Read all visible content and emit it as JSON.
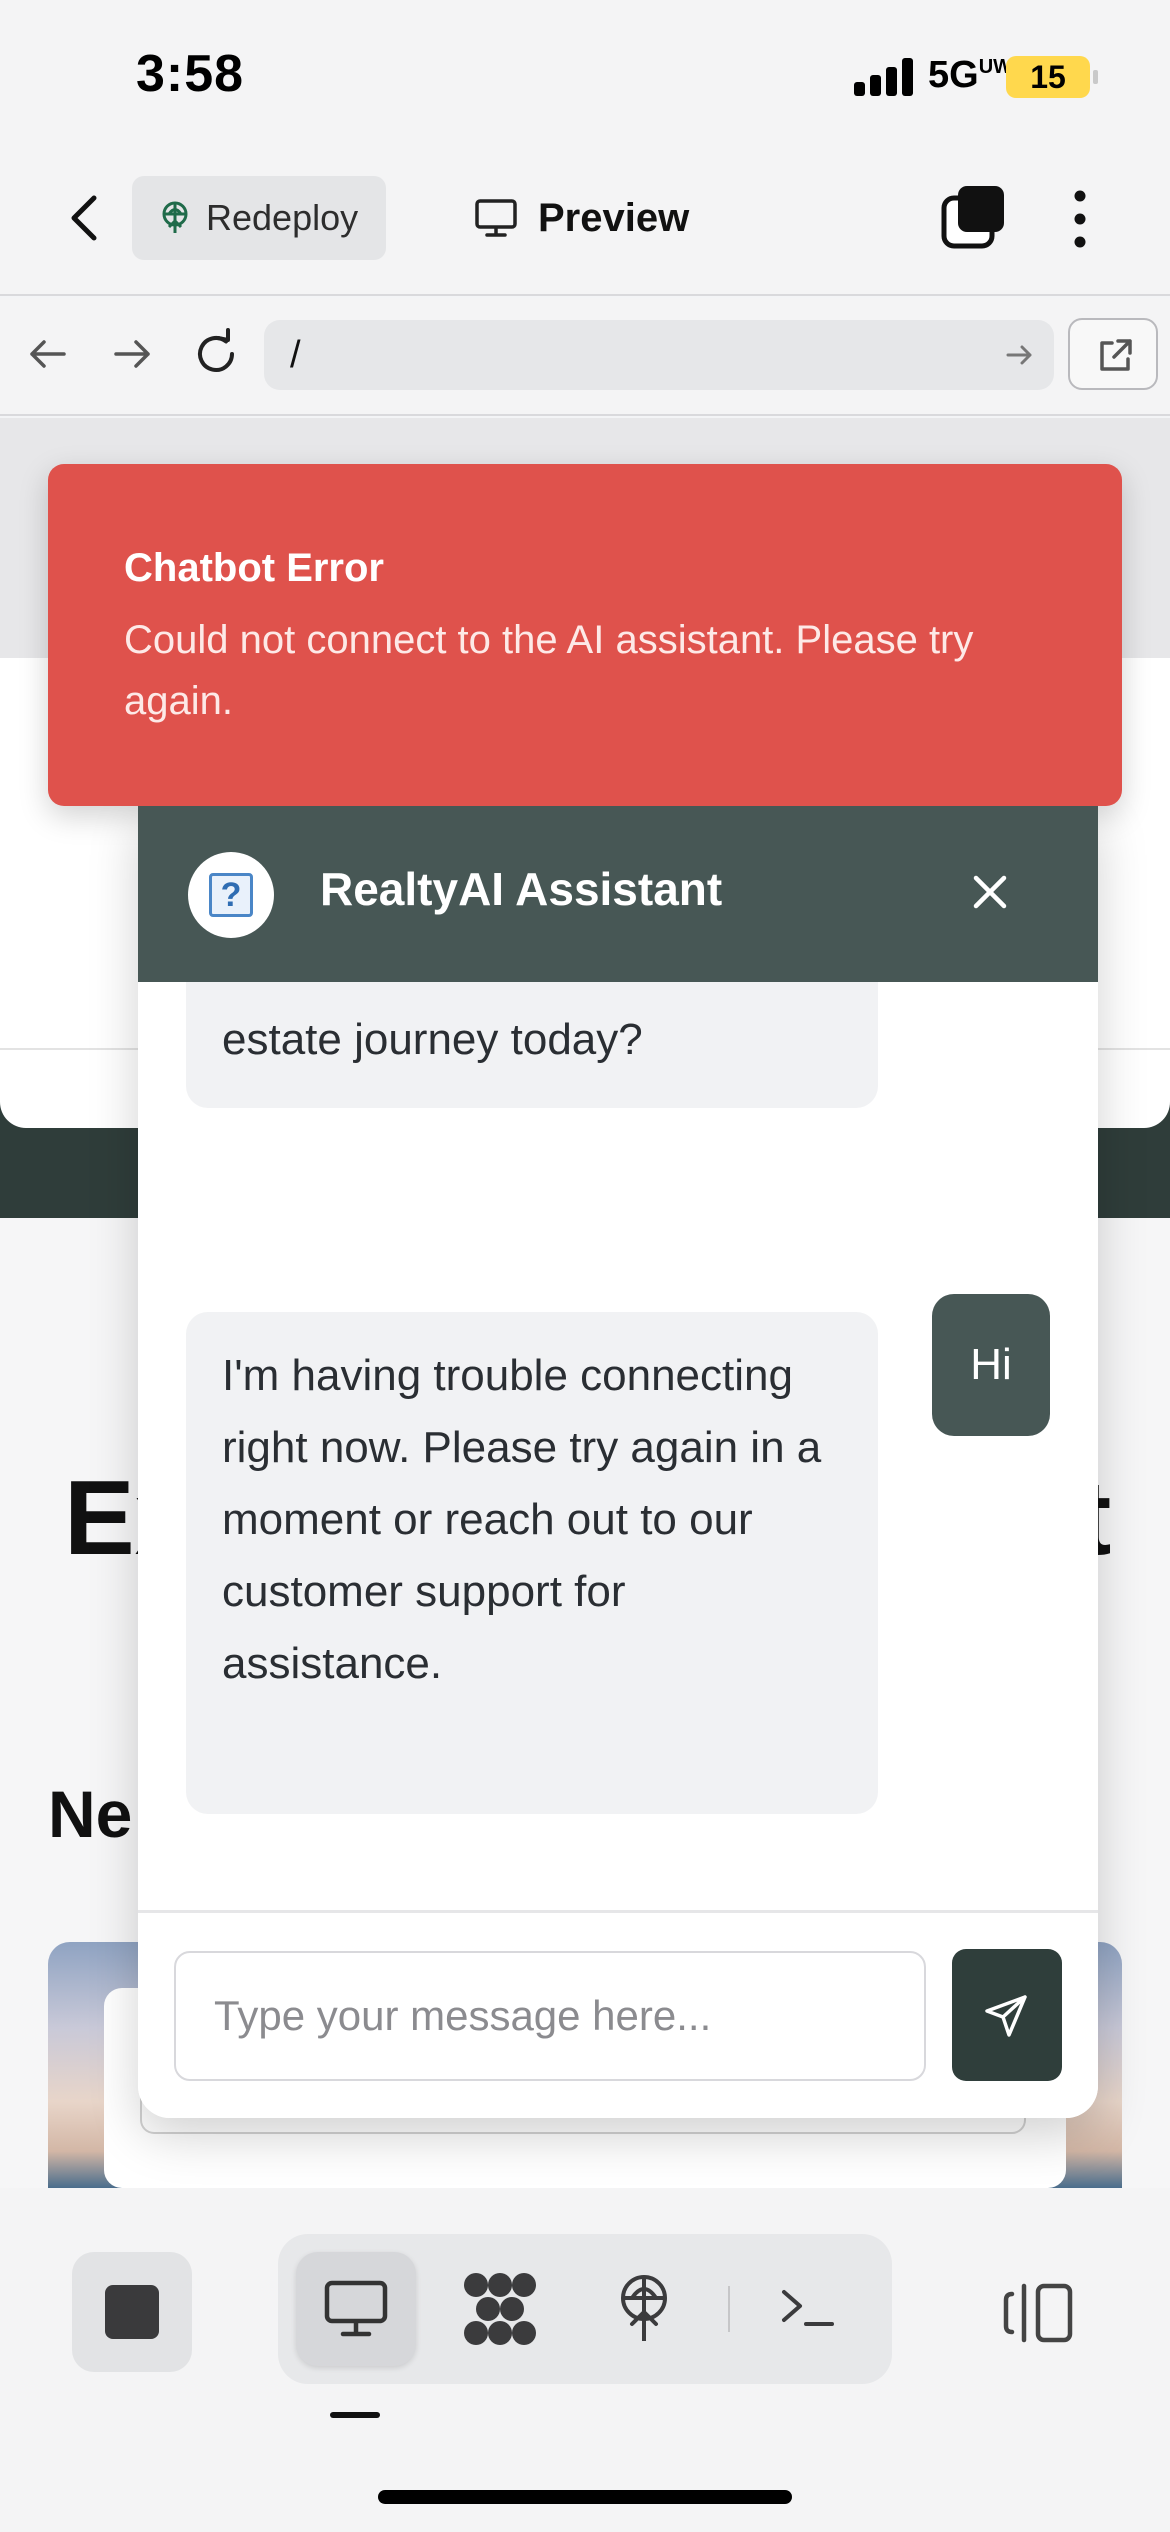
{
  "status_bar": {
    "time": "3:58",
    "network": "5G",
    "network_suffix": "UW",
    "battery": "15"
  },
  "header": {
    "redeploy_label": "Redeploy",
    "preview_label": "Preview"
  },
  "browser": {
    "url": "/"
  },
  "error_toast": {
    "title": "Chatbot Error",
    "message": "Could not connect to the AI assistant. Please try again."
  },
  "chat": {
    "title": "RealtyAI Assistant",
    "messages": [
      {
        "role": "assistant",
        "text": "estate journey today?"
      },
      {
        "role": "user",
        "text": "Hi"
      },
      {
        "role": "assistant",
        "text": "I'm having trouble connecting right now. Please try again in a moment or reach out to our customer support for assistance."
      }
    ],
    "input_placeholder": "Type your message here..."
  },
  "background_page": {
    "heading_start": "Ex",
    "heading_end": "t",
    "subheading_start": "Ne"
  },
  "colors": {
    "toast_red": "#df524c",
    "chat_header": "#475755",
    "send_button": "#2f3e3b"
  }
}
